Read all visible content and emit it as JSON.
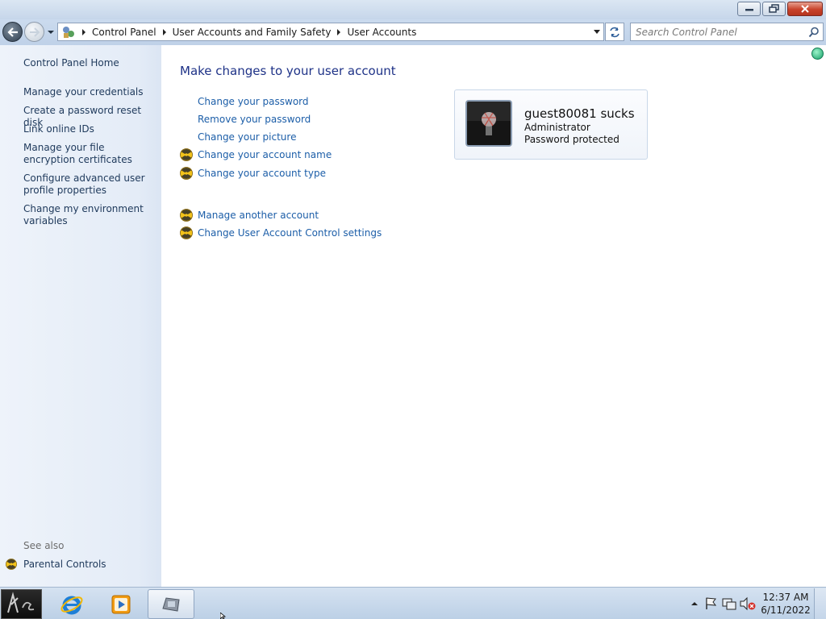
{
  "breadcrumbs": [
    "Control Panel",
    "User Accounts and Family Safety",
    "User Accounts"
  ],
  "search": {
    "placeholder": "Search Control Panel"
  },
  "left_pane": {
    "home": "Control Panel Home",
    "links": [
      "Manage your credentials",
      "Create a password reset disk",
      "Link online IDs",
      "Manage your file encryption certificates",
      "Configure advanced user profile properties",
      "Change my environment variables"
    ],
    "see_also_label": "See also",
    "see_also_links": [
      "Parental Controls"
    ]
  },
  "main": {
    "title": "Make changes to your user account",
    "tasks": [
      {
        "label": "Change your password",
        "shield": false
      },
      {
        "label": "Remove your password",
        "shield": false
      },
      {
        "label": "Change your picture",
        "shield": false
      },
      {
        "label": "Change your account name",
        "shield": true
      },
      {
        "label": "Change your account type",
        "shield": true
      }
    ],
    "other_tasks": [
      {
        "label": "Manage another account",
        "shield": true
      },
      {
        "label": "Change User Account Control settings",
        "shield": true
      }
    ]
  },
  "account": {
    "name": "guest80081 sucks",
    "type": "Administrator",
    "status": "Password protected"
  },
  "taskbar": {
    "start_logo": "start-orb",
    "pinned": [
      "internet-explorer-icon",
      "media-player-icon",
      "control-panel-icon"
    ],
    "clock": {
      "time": "12:37 AM",
      "date": "6/11/2022"
    }
  },
  "colors": {
    "link": "#1c5ea8",
    "title": "#1e3287",
    "left_link": "#1e395b",
    "shield_yellow": "#f2c21a"
  }
}
